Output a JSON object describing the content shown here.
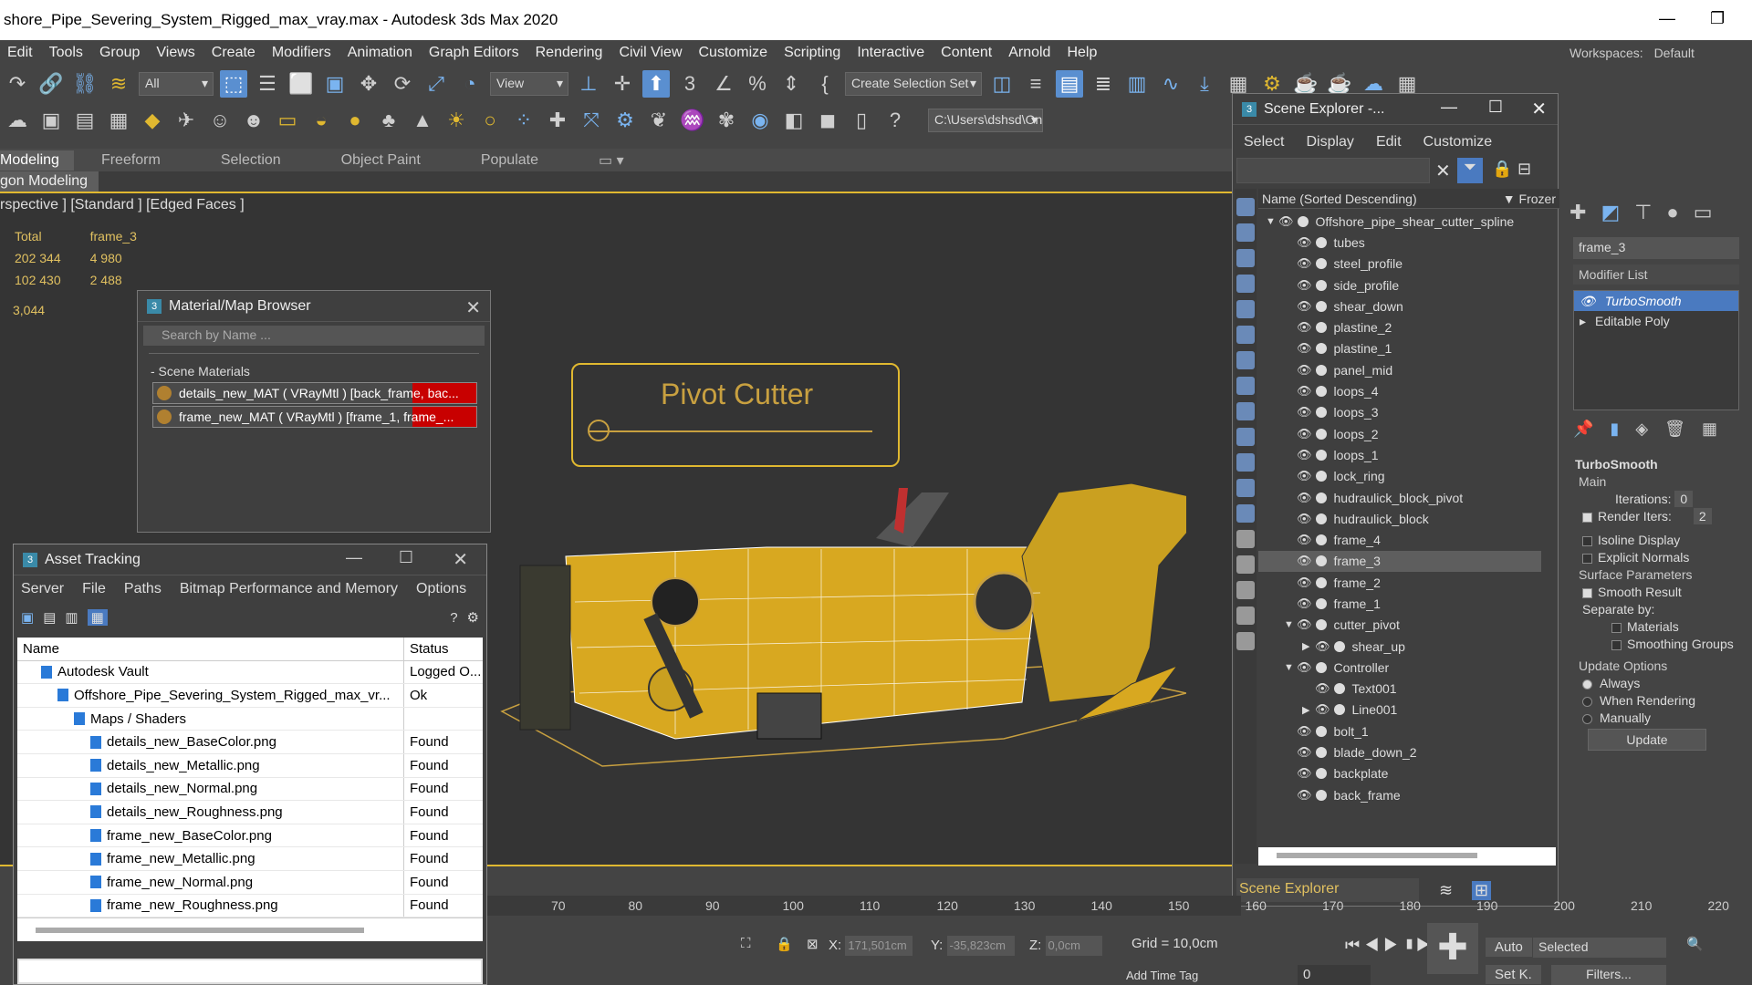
{
  "title": "shore_Pipe_Severing_System_Rigged_max_vray.max - Autodesk 3ds Max 2020",
  "menu": [
    "Edit",
    "Tools",
    "Group",
    "Views",
    "Create",
    "Modifiers",
    "Animation",
    "Graph Editors",
    "Rendering",
    "Civil View",
    "Customize",
    "Scripting",
    "Interactive",
    "Content",
    "Arnold",
    "Help"
  ],
  "workspaces": "Workspaces:",
  "workspace_value": "Default",
  "toolbar": {
    "filter": "All",
    "ref_coord": "View",
    "selection_set": "Create Selection Set",
    "path": "C:\\Users\\dshsd\\On"
  },
  "ribbon": {
    "tabs": [
      "Modeling",
      "Freeform",
      "Selection",
      "Object Paint",
      "Populate"
    ],
    "sub": "gon Modeling"
  },
  "viewport": {
    "label": "rspective ] [Standard ] [Edged Faces ]",
    "stats": {
      "h1": "Total",
      "h2": "frame_3",
      "r1a": "202 344",
      "r1b": "4 980",
      "r2a": "102 430",
      "r2b": "2 488",
      "fps": "3,044"
    },
    "card": "Pivot Cutter"
  },
  "material_browser": {
    "title": "Material/Map Browser",
    "search": "Search by Name ...",
    "section": "- Scene Materials",
    "items": [
      "details_new_MAT  ( VRayMtl )  [back_frame, bac...",
      "frame_new_MAT  ( VRayMtl )  [frame_1, frame_..."
    ]
  },
  "asset_tracking": {
    "title": "Asset Tracking",
    "menu": [
      "Server",
      "File",
      "Paths",
      "Bitmap Performance and Memory",
      "Options"
    ],
    "col_name": "Name",
    "col_status": "Status",
    "rows": [
      {
        "name": "Autodesk Vault",
        "status": "Logged O...",
        "indent": 1
      },
      {
        "name": "Offshore_Pipe_Severing_System_Rigged_max_vr...",
        "status": "Ok",
        "indent": 2
      },
      {
        "name": "Maps / Shaders",
        "status": "",
        "indent": 3
      },
      {
        "name": "details_new_BaseColor.png",
        "status": "Found",
        "indent": 4
      },
      {
        "name": "details_new_Metallic.png",
        "status": "Found",
        "indent": 4
      },
      {
        "name": "details_new_Normal.png",
        "status": "Found",
        "indent": 4
      },
      {
        "name": "details_new_Roughness.png",
        "status": "Found",
        "indent": 4
      },
      {
        "name": "frame_new_BaseColor.png",
        "status": "Found",
        "indent": 4
      },
      {
        "name": "frame_new_Metallic.png",
        "status": "Found",
        "indent": 4
      },
      {
        "name": "frame_new_Normal.png",
        "status": "Found",
        "indent": 4
      },
      {
        "name": "frame_new_Roughness.png",
        "status": "Found",
        "indent": 4
      }
    ]
  },
  "scene_explorer": {
    "title": "Scene Explorer -...",
    "menu": [
      "Select",
      "Display",
      "Edit",
      "Customize"
    ],
    "col_name": "Name (Sorted Descending)",
    "col_frozen": "▼ Frozer",
    "footer": "Scene Explorer",
    "nodes": [
      {
        "name": "Offshore_pipe_shear_cutter_spline",
        "level": 0,
        "arrow": "▼"
      },
      {
        "name": "tubes",
        "level": 1
      },
      {
        "name": "steel_profile",
        "level": 1
      },
      {
        "name": "side_profile",
        "level": 1
      },
      {
        "name": "shear_down",
        "level": 1
      },
      {
        "name": "plastine_2",
        "level": 1
      },
      {
        "name": "plastine_1",
        "level": 1
      },
      {
        "name": "panel_mid",
        "level": 1
      },
      {
        "name": "loops_4",
        "level": 1
      },
      {
        "name": "loops_3",
        "level": 1
      },
      {
        "name": "loops_2",
        "level": 1
      },
      {
        "name": "loops_1",
        "level": 1
      },
      {
        "name": "lock_ring",
        "level": 1
      },
      {
        "name": "hudraulick_block_pivot",
        "level": 1
      },
      {
        "name": "hudraulick_block",
        "level": 1
      },
      {
        "name": "frame_4",
        "level": 1
      },
      {
        "name": "frame_3",
        "level": 1,
        "sel": true
      },
      {
        "name": "frame_2",
        "level": 1
      },
      {
        "name": "frame_1",
        "level": 1
      },
      {
        "name": "cutter_pivot",
        "level": 1,
        "arrow": "▼"
      },
      {
        "name": "shear_up",
        "level": 2,
        "arrow": "▶"
      },
      {
        "name": "Controller",
        "level": 1,
        "arrow": "▼"
      },
      {
        "name": "Text001",
        "level": 2
      },
      {
        "name": "Line001",
        "level": 2,
        "arrow": "▶"
      },
      {
        "name": "bolt_1",
        "level": 1
      },
      {
        "name": "blade_down_2",
        "level": 1
      },
      {
        "name": "backplate",
        "level": 1
      },
      {
        "name": "back_frame",
        "level": 1
      }
    ]
  },
  "command_panel": {
    "object": "frame_3",
    "modifier_list": "Modifier List",
    "stack": [
      "TurboSmooth",
      "Editable Poly"
    ],
    "section": "TurboSmooth",
    "main": "Main",
    "iterations": "Iterations:",
    "iterations_val": "0",
    "render_iters": "Render Iters:",
    "render_iters_val": "2",
    "isoline": "Isoline Display",
    "explicit": "Explicit Normals",
    "surface": "Surface Parameters",
    "smooth": "Smooth Result",
    "separate": "Separate by:",
    "materials": "Materials",
    "smoothing": "Smoothing Groups",
    "update_opts": "Update Options",
    "always": "Always",
    "when_render": "When Rendering",
    "manually": "Manually",
    "update": "Update"
  },
  "timeline": {
    "ticks": [
      "70",
      "80",
      "90",
      "100",
      "110",
      "120",
      "130",
      "140",
      "150",
      "160",
      "170",
      "180",
      "190",
      "200",
      "210",
      "220"
    ]
  },
  "status": {
    "x": "171,501cm",
    "y": "-35,823cm",
    "z": "0,0cm",
    "grid": "Grid = 10,0cm",
    "auto": "Auto",
    "setk": "Set K.",
    "selected": "Selected",
    "filters": "Filters...",
    "frame": "0",
    "timetag": "Add Time Tag"
  }
}
